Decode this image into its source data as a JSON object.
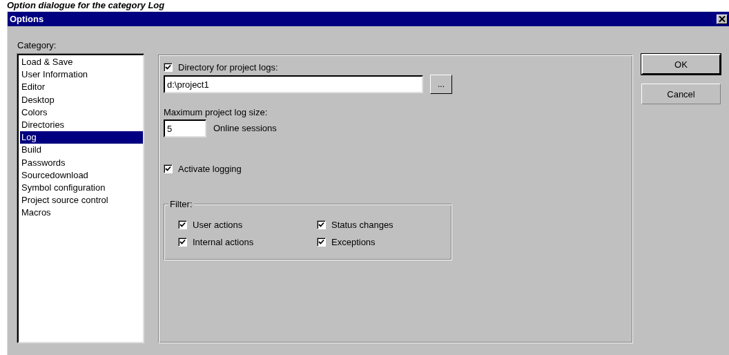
{
  "caption": "Option dialogue for the category Log",
  "window": {
    "title": "Options"
  },
  "category": {
    "label": "Category:",
    "items": [
      {
        "label": "Load & Save",
        "selected": false
      },
      {
        "label": "User Information",
        "selected": false
      },
      {
        "label": "Editor",
        "selected": false
      },
      {
        "label": "Desktop",
        "selected": false
      },
      {
        "label": "Colors",
        "selected": false
      },
      {
        "label": "Directories",
        "selected": false
      },
      {
        "label": "Log",
        "selected": true
      },
      {
        "label": "Build",
        "selected": false
      },
      {
        "label": "Passwords",
        "selected": false
      },
      {
        "label": "Sourcedownload",
        "selected": false
      },
      {
        "label": "Symbol configuration",
        "selected": false
      },
      {
        "label": "Project source control",
        "selected": false
      },
      {
        "label": "Macros",
        "selected": false
      }
    ]
  },
  "log": {
    "directory": {
      "label": "Directory for project logs:",
      "checked": true,
      "value": "d:\\project1",
      "browse": "..."
    },
    "max_size": {
      "label": "Maximum project log size:",
      "value": "5",
      "unit": "Online sessions"
    },
    "activate": {
      "label": "Activate logging",
      "checked": true
    },
    "filter": {
      "title": "Filter:",
      "options": [
        {
          "label": "User actions",
          "checked": true
        },
        {
          "label": "Status changes",
          "checked": true
        },
        {
          "label": "Internal actions",
          "checked": true
        },
        {
          "label": "Exceptions",
          "checked": true
        }
      ]
    }
  },
  "buttons": [
    {
      "label": "OK",
      "default": true
    },
    {
      "label": "Cancel",
      "default": false
    }
  ]
}
